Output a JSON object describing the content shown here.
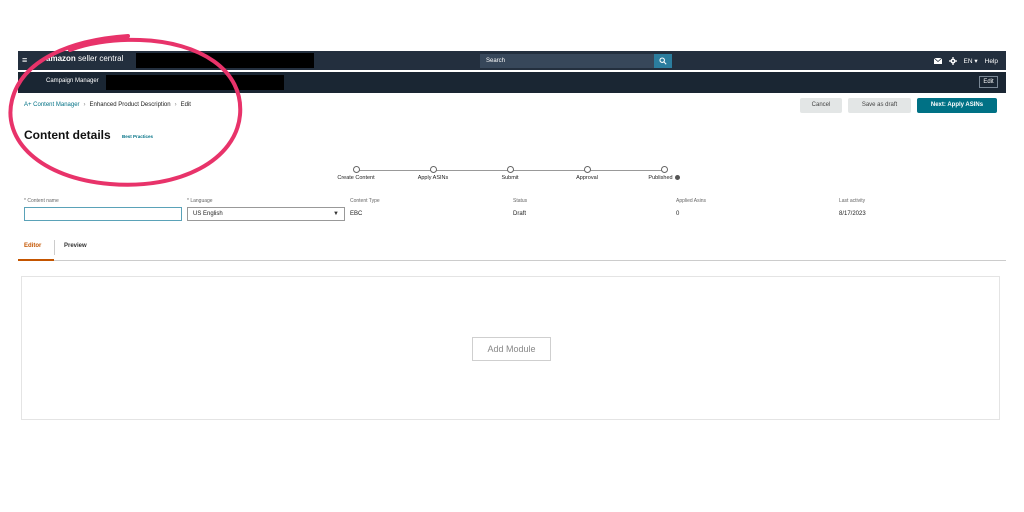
{
  "topbar": {
    "menu_glyph": "≡",
    "logo_brand": "amazon",
    "logo_suffix": " seller central",
    "search_placeholder": "Search",
    "search_icon": "magnifier-icon",
    "mail_icon": "envelope-icon",
    "settings_icon": "gear-icon",
    "language": "EN ▾",
    "help": "Help"
  },
  "subbar": {
    "title": "Campaign Manager",
    "edit_label": "Edit"
  },
  "breadcrumb": {
    "items": [
      "A+ Content Manager",
      "Enhanced Product Description",
      "Edit"
    ],
    "separator": "›"
  },
  "actions": {
    "cancel": "Cancel",
    "save_draft": "Save as draft",
    "next": "Next: Apply ASINs"
  },
  "page": {
    "title": "Content details",
    "best_practices": "Best Practices"
  },
  "steps": [
    "Create Content",
    "Apply ASINs",
    "Submit",
    "Approval",
    "Published"
  ],
  "fields": {
    "content_name": {
      "label": "* Content name",
      "value": ""
    },
    "language": {
      "label": "* Language",
      "value": "US English"
    },
    "content_type": {
      "label": "Content Type",
      "value": "EBC"
    },
    "status": {
      "label": "Status",
      "value": "Draft"
    },
    "applied_asins": {
      "label": "Applied Asins",
      "value": "0"
    },
    "last_activity": {
      "label": "Last activity",
      "value": "8/17/2023"
    }
  },
  "tabs": {
    "editor": "Editor",
    "preview": "Preview"
  },
  "editor": {
    "add_module": "Add Module"
  },
  "colors": {
    "topbar": "#232f3e",
    "accent_link": "#007185",
    "primary_button": "#007185",
    "active_tab": "#c45500",
    "annotation": "#e8336a"
  }
}
